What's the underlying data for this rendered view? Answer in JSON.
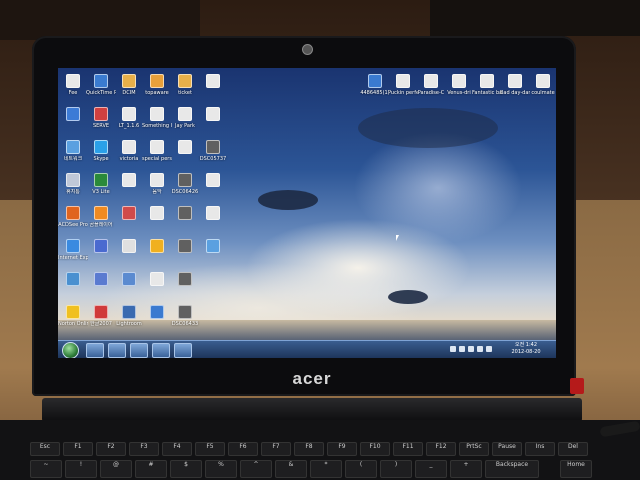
{
  "scene": {
    "laptop_brand": "acer"
  },
  "desktop": {
    "icons_col1": [
      {
        "label": "Fee",
        "color": "#e8e8e8"
      },
      {
        "label": "",
        "color": "#3c7bd6"
      },
      {
        "label": "네트워크",
        "color": "#5aa0e0"
      },
      {
        "label": "휴지통",
        "color": "#bfc8d8"
      },
      {
        "label": "ACDSee Pro",
        "color": "#e0641e"
      },
      {
        "label": "Internet Explorer",
        "color": "#3a8ae0"
      },
      {
        "label": "",
        "color": "#4a90d0"
      },
      {
        "label": "Norton Onlin",
        "color": "#f0c020"
      }
    ],
    "icons_col2": [
      {
        "label": "QuickTime Player",
        "color": "#3a7bd0"
      },
      {
        "label": "SERVE",
        "color": "#d04040"
      },
      {
        "label": "Skype",
        "color": "#2aa0e8"
      },
      {
        "label": "V3 Lite",
        "color": "#2a8a3a"
      },
      {
        "label": "곰플레이어",
        "color": "#f08a20"
      },
      {
        "label": "",
        "color": "#4a6ad0"
      },
      {
        "label": "",
        "color": "#5a7ad0"
      },
      {
        "label": "한글2007",
        "color": "#d03a3a"
      }
    ],
    "icons_col3": [
      {
        "label": "DCIM",
        "color": "#e8b04a"
      },
      {
        "label": "LT_1.1.6",
        "color": "#e8e8e8"
      },
      {
        "label": "victoria",
        "color": "#e8e8e8"
      },
      {
        "label": "",
        "color": "#e8e8e8"
      },
      {
        "label": "",
        "color": "#d04a4a"
      },
      {
        "label": "",
        "color": "#e0e0e0"
      },
      {
        "label": "",
        "color": "#5a8ad0"
      },
      {
        "label": "Lightroom",
        "color": "#3a6ab0"
      }
    ],
    "icons_col4": [
      {
        "label": "topaware",
        "color": "#e8a03a"
      },
      {
        "label": "Something I Can't live",
        "color": "#e8e8e8"
      },
      {
        "label": "special person",
        "color": "#e8e8e8"
      },
      {
        "label": "음악",
        "color": "#e8e8e8"
      },
      {
        "label": "",
        "color": "#e8e8e8"
      },
      {
        "label": "",
        "color": "#f0b020"
      },
      {
        "label": "",
        "color": "#e8e8e8"
      },
      {
        "label": "",
        "color": "#3a7ad0"
      }
    ],
    "icons_col5": [
      {
        "label": "ticket",
        "color": "#e8b04a"
      },
      {
        "label": "Jay Park",
        "color": "#e8e8e8"
      },
      {
        "label": "",
        "color": "#e8e8e8"
      },
      {
        "label": "DSC06426",
        "color": "#606060"
      },
      {
        "label": "",
        "color": "#606060"
      },
      {
        "label": "",
        "color": "#606060"
      },
      {
        "label": "",
        "color": "#606060"
      },
      {
        "label": "DSC06433",
        "color": "#606060"
      }
    ],
    "icons_col6": [
      {
        "label": "",
        "color": "#e8e8e8"
      },
      {
        "label": "",
        "color": "#e8e8e8"
      },
      {
        "label": "DSC05737",
        "color": "#606060"
      },
      {
        "label": "",
        "color": "#e8e8e8"
      },
      {
        "label": "",
        "color": "#e8e8e8"
      },
      {
        "label": "",
        "color": "#5aa0e0"
      }
    ],
    "icons_top_right": [
      {
        "label": "4486485(1)",
        "color": "#3a7ad0"
      },
      {
        "label": "Puckin perfect",
        "color": "#e8e8e8"
      },
      {
        "label": "Paradise-C",
        "color": "#e8e8e8"
      },
      {
        "label": "Venus-dri",
        "color": "#e8e8e8"
      },
      {
        "label": "Fantastic baby",
        "color": "#e8e8e8"
      },
      {
        "label": "Bad day-dani",
        "color": "#e8e8e8"
      },
      {
        "label": "coulmate",
        "color": "#e8e8e8"
      }
    ]
  },
  "taskbar": {
    "clock_time": "오전 1:42",
    "clock_date": "2012-08-20"
  },
  "keyboard": {
    "row_fn": [
      "Esc",
      "F1",
      "F2",
      "F3",
      "F4",
      "F5",
      "F6",
      "F7",
      "F8",
      "F9",
      "F10",
      "F11",
      "F12",
      "PrtSc",
      "Pause",
      "Ins",
      "Del"
    ],
    "row_num": [
      "~",
      "!",
      "@",
      "#",
      "$",
      "%",
      "^",
      "&",
      "*",
      "(",
      ")",
      "_",
      "+",
      "Backspace",
      "Home"
    ]
  }
}
